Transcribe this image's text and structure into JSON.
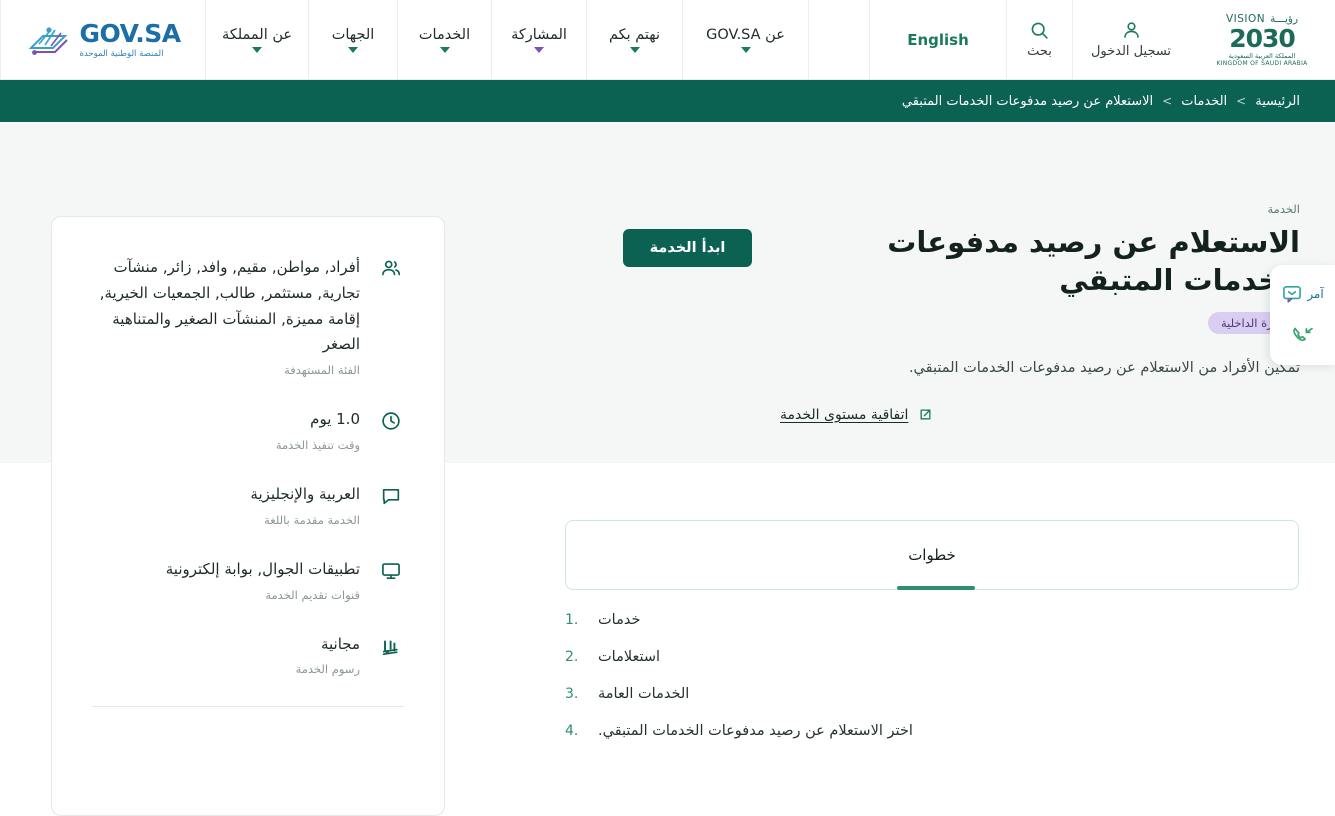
{
  "header": {
    "vision_logo": {
      "word": "VISION",
      "word_ar": "رؤيـــة",
      "year": "2030",
      "sub_ar": "المملكة العربية السعودية",
      "sub_en": "KINGDOM OF SAUDI ARABIA"
    },
    "gov_logo": {
      "name": "GOV.SA",
      "tagline": "المنصة الوطنية الموحدة"
    },
    "nav": [
      {
        "label": "عن المملكة",
        "chevron": "chevron-down-icon",
        "accent": "green"
      },
      {
        "label": "الجهات",
        "chevron": "chevron-down-icon",
        "accent": "green"
      },
      {
        "label": "الخدمات",
        "chevron": "chevron-down-icon",
        "accent": "green"
      },
      {
        "label": "المشاركة",
        "chevron": "chevron-down-icon",
        "accent": "purple"
      },
      {
        "label": "نهتم بكم",
        "chevron": "chevron-down-icon",
        "accent": "green"
      },
      {
        "label": "عن GOV.SA",
        "chevron": "chevron-down-icon",
        "accent": "green"
      }
    ],
    "language_toggle": "English",
    "search_label": "بحث",
    "login_label": "تسجيل الدخول"
  },
  "breadcrumb": {
    "items": [
      "الرئيسية",
      "الخدمات",
      "الاستعلام عن رصيد مدفوعات الخدمات المتبقي"
    ],
    "separator": ">"
  },
  "hero": {
    "eyebrow": "الخدمة",
    "title": "الاستعلام عن رصيد مدفوعات الخدمات المتبقي",
    "ministry_badge": "وزارة الداخلية",
    "description": "تمكين الأفراد من الاستعلام عن رصيد مدفوعات الخدمات المتبقي.",
    "sla_link": "اتفاقية مستوى الخدمة",
    "start_button": "ابدأ الخدمة"
  },
  "info_card": {
    "rows": [
      {
        "icon": "users-icon",
        "value": "أفراد, مواطن, مقيم, وافد, زائر, منشآت تجارية, مستثمر, طالب, الجمعيات الخيرية, إقامة مميزة, المنشآت الصغير والمتناهية الصغر",
        "label": "الفئة المستهدفة"
      },
      {
        "icon": "clock-icon",
        "value": "1.0 يوم",
        "label": "وقت تنفيذ الخدمة"
      },
      {
        "icon": "chat-icon",
        "value": "العربية والإنجليزية",
        "label": "الخدمة مقدمة باللغة"
      },
      {
        "icon": "monitor-icon",
        "value": "تطبيقات الجوال, بوابة إلكترونية",
        "label": "قنوات تقديم الخدمة"
      },
      {
        "icon": "riyal-icon",
        "value": "مجانية",
        "label": "رسوم الخدمة"
      }
    ]
  },
  "tabs": {
    "items": [
      {
        "label": "خطوات",
        "active": true
      }
    ]
  },
  "steps": {
    "items": [
      {
        "num": "1.",
        "text": "خدمات"
      },
      {
        "num": "2.",
        "text": "استعلامات"
      },
      {
        "num": "3.",
        "text": "الخدمات العامة"
      },
      {
        "num": "4.",
        "text": "اختر الاستعلام عن رصيد مدفوعات الخدمات المتبقي."
      }
    ]
  },
  "float_widget": {
    "label": "آمر",
    "chat_icon": "chat-bubble-icon",
    "call_icon": "phone-callback-icon"
  },
  "colors": {
    "brand_green": "#0b6152",
    "accent_green": "#2f8f6e",
    "breadcrumb_bg": "#0b6152",
    "hero_bg": "#f4f7f6",
    "badge_bg": "#d9cdf2",
    "badge_text": "#4a3a7a",
    "gov_blue": "#1b6ea8",
    "purple_chevron": "#7a51b5"
  }
}
